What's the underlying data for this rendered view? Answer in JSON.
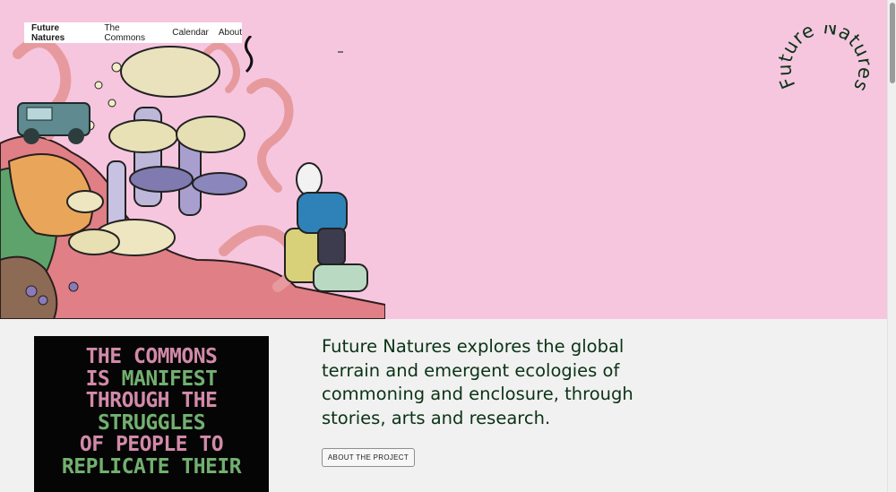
{
  "nav": {
    "items": [
      {
        "label": "Future Natures",
        "active": true
      },
      {
        "label": "The Commons"
      },
      {
        "label": "Calendar"
      },
      {
        "label": "About"
      }
    ]
  },
  "logo": {
    "text": "Future Natures"
  },
  "intro": {
    "text": "Future Natures explores the global terrain and emergent ecologies of commoning and enclosure, through stories, arts and research.",
    "button_label": "ABOUT THE PROJECT"
  },
  "poster": {
    "lines": [
      {
        "text": "THE COMMONS",
        "color": "rose"
      },
      {
        "text": "IS MANIFEST",
        "color": "mixed"
      },
      {
        "text": "THROUGH THE",
        "color": "rose"
      },
      {
        "text": "STRUGGLES",
        "color": "green"
      },
      {
        "text": "OF PEOPLE TO",
        "color": "rose"
      },
      {
        "text": "REPLICATE THEIR",
        "color": "green"
      }
    ]
  },
  "colors": {
    "hero_bg": "#f6c6df",
    "page_bg": "#f1f1f1",
    "text_dark_green": "#0b3316",
    "poster_rose": "#d28aa8",
    "poster_green": "#72b06f"
  }
}
